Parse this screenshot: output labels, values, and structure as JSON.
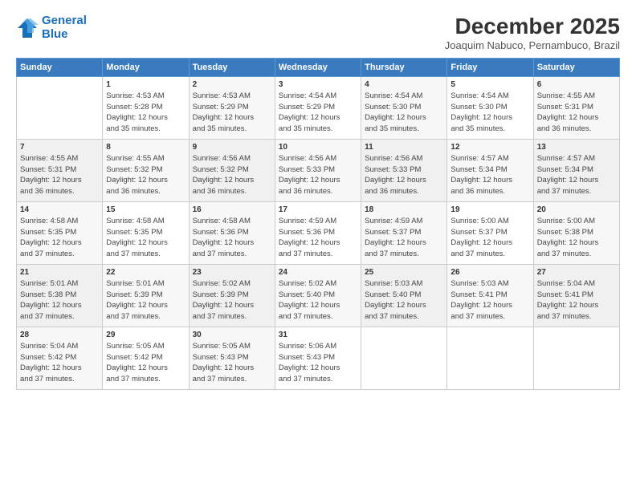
{
  "header": {
    "logo_line1": "General",
    "logo_line2": "Blue",
    "month": "December 2025",
    "location": "Joaquim Nabuco, Pernambuco, Brazil"
  },
  "weekdays": [
    "Sunday",
    "Monday",
    "Tuesday",
    "Wednesday",
    "Thursday",
    "Friday",
    "Saturday"
  ],
  "weeks": [
    [
      {
        "day": "",
        "info": ""
      },
      {
        "day": "1",
        "info": "Sunrise: 4:53 AM\nSunset: 5:28 PM\nDaylight: 12 hours\nand 35 minutes."
      },
      {
        "day": "2",
        "info": "Sunrise: 4:53 AM\nSunset: 5:29 PM\nDaylight: 12 hours\nand 35 minutes."
      },
      {
        "day": "3",
        "info": "Sunrise: 4:54 AM\nSunset: 5:29 PM\nDaylight: 12 hours\nand 35 minutes."
      },
      {
        "day": "4",
        "info": "Sunrise: 4:54 AM\nSunset: 5:30 PM\nDaylight: 12 hours\nand 35 minutes."
      },
      {
        "day": "5",
        "info": "Sunrise: 4:54 AM\nSunset: 5:30 PM\nDaylight: 12 hours\nand 35 minutes."
      },
      {
        "day": "6",
        "info": "Sunrise: 4:55 AM\nSunset: 5:31 PM\nDaylight: 12 hours\nand 36 minutes."
      }
    ],
    [
      {
        "day": "7",
        "info": "Sunrise: 4:55 AM\nSunset: 5:31 PM\nDaylight: 12 hours\nand 36 minutes."
      },
      {
        "day": "8",
        "info": "Sunrise: 4:55 AM\nSunset: 5:32 PM\nDaylight: 12 hours\nand 36 minutes."
      },
      {
        "day": "9",
        "info": "Sunrise: 4:56 AM\nSunset: 5:32 PM\nDaylight: 12 hours\nand 36 minutes."
      },
      {
        "day": "10",
        "info": "Sunrise: 4:56 AM\nSunset: 5:33 PM\nDaylight: 12 hours\nand 36 minutes."
      },
      {
        "day": "11",
        "info": "Sunrise: 4:56 AM\nSunset: 5:33 PM\nDaylight: 12 hours\nand 36 minutes."
      },
      {
        "day": "12",
        "info": "Sunrise: 4:57 AM\nSunset: 5:34 PM\nDaylight: 12 hours\nand 36 minutes."
      },
      {
        "day": "13",
        "info": "Sunrise: 4:57 AM\nSunset: 5:34 PM\nDaylight: 12 hours\nand 37 minutes."
      }
    ],
    [
      {
        "day": "14",
        "info": "Sunrise: 4:58 AM\nSunset: 5:35 PM\nDaylight: 12 hours\nand 37 minutes."
      },
      {
        "day": "15",
        "info": "Sunrise: 4:58 AM\nSunset: 5:35 PM\nDaylight: 12 hours\nand 37 minutes."
      },
      {
        "day": "16",
        "info": "Sunrise: 4:58 AM\nSunset: 5:36 PM\nDaylight: 12 hours\nand 37 minutes."
      },
      {
        "day": "17",
        "info": "Sunrise: 4:59 AM\nSunset: 5:36 PM\nDaylight: 12 hours\nand 37 minutes."
      },
      {
        "day": "18",
        "info": "Sunrise: 4:59 AM\nSunset: 5:37 PM\nDaylight: 12 hours\nand 37 minutes."
      },
      {
        "day": "19",
        "info": "Sunrise: 5:00 AM\nSunset: 5:37 PM\nDaylight: 12 hours\nand 37 minutes."
      },
      {
        "day": "20",
        "info": "Sunrise: 5:00 AM\nSunset: 5:38 PM\nDaylight: 12 hours\nand 37 minutes."
      }
    ],
    [
      {
        "day": "21",
        "info": "Sunrise: 5:01 AM\nSunset: 5:38 PM\nDaylight: 12 hours\nand 37 minutes."
      },
      {
        "day": "22",
        "info": "Sunrise: 5:01 AM\nSunset: 5:39 PM\nDaylight: 12 hours\nand 37 minutes."
      },
      {
        "day": "23",
        "info": "Sunrise: 5:02 AM\nSunset: 5:39 PM\nDaylight: 12 hours\nand 37 minutes."
      },
      {
        "day": "24",
        "info": "Sunrise: 5:02 AM\nSunset: 5:40 PM\nDaylight: 12 hours\nand 37 minutes."
      },
      {
        "day": "25",
        "info": "Sunrise: 5:03 AM\nSunset: 5:40 PM\nDaylight: 12 hours\nand 37 minutes."
      },
      {
        "day": "26",
        "info": "Sunrise: 5:03 AM\nSunset: 5:41 PM\nDaylight: 12 hours\nand 37 minutes."
      },
      {
        "day": "27",
        "info": "Sunrise: 5:04 AM\nSunset: 5:41 PM\nDaylight: 12 hours\nand 37 minutes."
      }
    ],
    [
      {
        "day": "28",
        "info": "Sunrise: 5:04 AM\nSunset: 5:42 PM\nDaylight: 12 hours\nand 37 minutes."
      },
      {
        "day": "29",
        "info": "Sunrise: 5:05 AM\nSunset: 5:42 PM\nDaylight: 12 hours\nand 37 minutes."
      },
      {
        "day": "30",
        "info": "Sunrise: 5:05 AM\nSunset: 5:43 PM\nDaylight: 12 hours\nand 37 minutes."
      },
      {
        "day": "31",
        "info": "Sunrise: 5:06 AM\nSunset: 5:43 PM\nDaylight: 12 hours\nand 37 minutes."
      },
      {
        "day": "",
        "info": ""
      },
      {
        "day": "",
        "info": ""
      },
      {
        "day": "",
        "info": ""
      }
    ]
  ]
}
